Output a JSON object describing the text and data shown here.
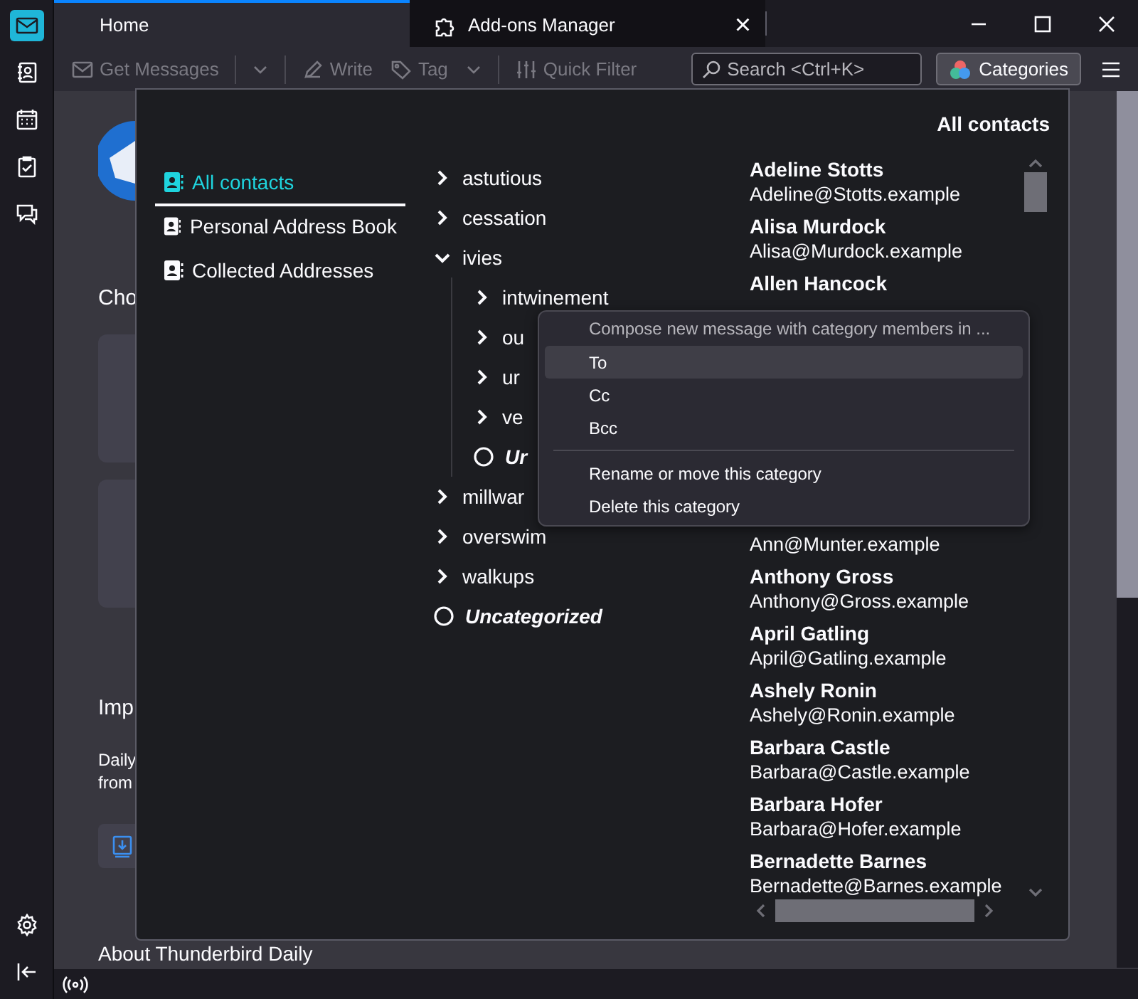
{
  "spaces": [
    {
      "kind": "mail",
      "selected": true
    },
    {
      "kind": "address-book",
      "selected": false
    },
    {
      "kind": "calendar",
      "selected": false
    },
    {
      "kind": "tasks",
      "selected": false
    },
    {
      "kind": "chat",
      "selected": false
    }
  ],
  "tabs": [
    {
      "kind": "home",
      "label": "Home",
      "selected": true,
      "closable": false
    },
    {
      "kind": "addon",
      "label": "Add-ons Manager",
      "selected": false,
      "closable": true
    }
  ],
  "close_tab_glyph": "×",
  "toolbar": {
    "buttons": [
      {
        "label": "Get Messages",
        "kind": "get-messages",
        "disabled": true,
        "dropdown": true
      },
      {
        "label": "Write",
        "kind": "write",
        "disabled": true,
        "dropdown": false
      },
      {
        "label": "Tag",
        "kind": "tag",
        "disabled": true,
        "dropdown": true
      },
      {
        "label": "Quick Filter",
        "kind": "filter",
        "disabled": true,
        "dropdown": false
      }
    ],
    "search": {
      "placeholder": "Search <Ctrl+K>"
    },
    "categories_button": {
      "label": "Categories"
    }
  },
  "home": {
    "heading": "Cho",
    "section_heading": "Imp",
    "text_lines": [
      "Daily",
      "from"
    ],
    "footer_heading": "About Thunderbird Daily"
  },
  "popup": {
    "title": "All contacts",
    "address_books": [
      {
        "label": "All contacts",
        "selected": true
      },
      {
        "label": "Personal Address Book",
        "selected": false
      },
      {
        "label": "Collected Addresses",
        "selected": false
      }
    ],
    "categories": [
      {
        "kind": "category",
        "label": "astutious",
        "expanded": false
      },
      {
        "kind": "category",
        "label": "cessation",
        "expanded": false
      },
      {
        "kind": "category",
        "label": "ivies",
        "expanded": true,
        "children": [
          {
            "kind": "category",
            "label": "intwinement",
            "expanded": false
          },
          {
            "kind": "category",
            "label": "ou",
            "expanded": false
          },
          {
            "kind": "category",
            "label": "ur",
            "expanded": false
          },
          {
            "kind": "category",
            "label": "ve",
            "expanded": false
          },
          {
            "kind": "uncategorized",
            "label": "Ur"
          }
        ]
      },
      {
        "kind": "category",
        "label": "millwar",
        "expanded": false
      },
      {
        "kind": "category",
        "label": "overswim",
        "expanded": false
      },
      {
        "kind": "category",
        "label": "walkups",
        "expanded": false
      },
      {
        "kind": "uncategorized",
        "label": "Uncategorized"
      }
    ],
    "contacts": [
      {
        "name": "Adeline Stotts",
        "email": "Adeline@Stotts.example"
      },
      {
        "name": "Alisa Murdock",
        "email": "Alisa@Murdock.example"
      },
      {
        "name": "Allen Hancock"
      },
      {
        "email": "Ann@Munter.example"
      },
      {
        "name": "Anthony Gross",
        "email": "Anthony@Gross.example"
      },
      {
        "name": "April Gatling",
        "email": "April@Gatling.example"
      },
      {
        "name": "Ashely Ronin",
        "email": "Ashely@Ronin.example"
      },
      {
        "name": "Barbara Castle",
        "email": "Barbara@Castle.example"
      },
      {
        "name": "Barbara Hofer",
        "email": "Barbara@Hofer.example"
      },
      {
        "name": "Bernadette Barnes",
        "email": "Bernadette@Barnes.example"
      }
    ],
    "context_menu": {
      "heading": "Compose new message with category members in ...",
      "groups": [
        [
          {
            "label": "To",
            "selected": true
          },
          {
            "label": "Cc",
            "selected": false
          },
          {
            "label": "Bcc",
            "selected": false
          }
        ],
        [
          {
            "label": "Rename or move this category",
            "selected": false
          },
          {
            "label": "Delete this category",
            "selected": false
          }
        ]
      ]
    }
  }
}
